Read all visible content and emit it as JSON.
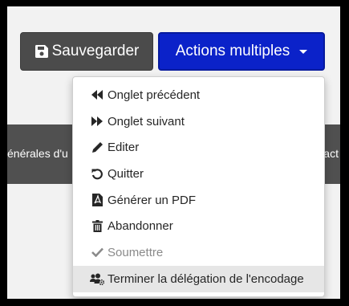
{
  "background_text": {
    "left": "énérales d'u",
    "right": "tact"
  },
  "toolbar": {
    "save_label": "Sauvegarder",
    "actions_label": "Actions multiples"
  },
  "menu": {
    "items": [
      {
        "label": "Onglet précédent",
        "icon": "backward-icon"
      },
      {
        "label": "Onglet suivant",
        "icon": "forward-icon"
      },
      {
        "label": "Editer",
        "icon": "pencil-icon"
      },
      {
        "label": "Quitter",
        "icon": "undo-icon"
      },
      {
        "label": "Générer un PDF",
        "icon": "pdf-file-icon"
      },
      {
        "label": "Abandonner",
        "icon": "trash-icon"
      },
      {
        "label": "Soumettre",
        "icon": "check-icon",
        "disabled": true
      },
      {
        "label": "Terminer la délégation de l'encodage",
        "icon": "users-cog-icon",
        "highlighted": true
      }
    ]
  },
  "colors": {
    "save_button": "#4b4b4b",
    "actions_button": "#0b22c9",
    "band": "#505050",
    "disabled_text": "#8a8a8a",
    "hover_item": "#e6e6e6"
  }
}
